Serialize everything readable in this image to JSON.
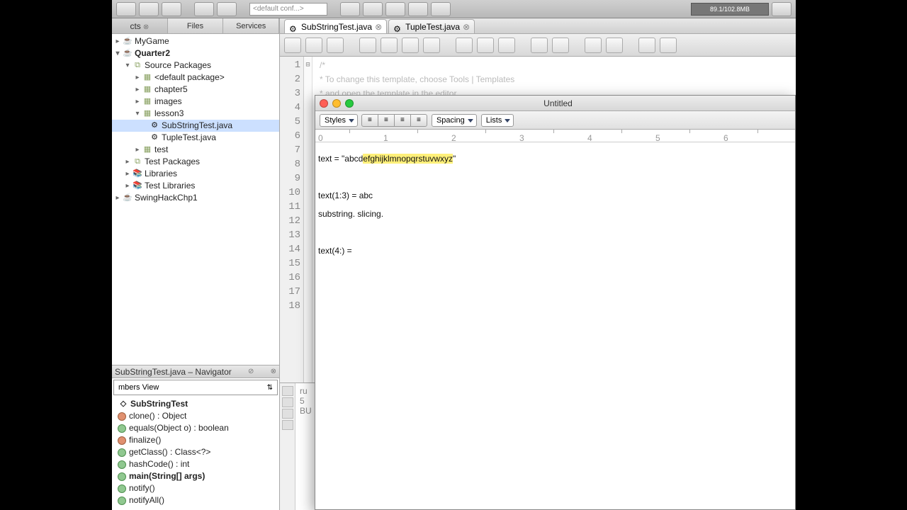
{
  "top_toolbar": {
    "config_dd": "<default conf...>",
    "memory": "89.1/102.8MB"
  },
  "project_tabs": {
    "tab1": "cts",
    "tab2": "Files",
    "tab3": "Services"
  },
  "tree": {
    "mygame": "MyGame",
    "quarter2": "Quarter2",
    "src_pkg": "Source Packages",
    "default_pkg": "<default package>",
    "chapter5": "chapter5",
    "images": "images",
    "lesson3": "lesson3",
    "substring": "SubStringTest.java",
    "tupletest": "TupleTest.java",
    "test": "test",
    "test_pkg": "Test Packages",
    "libraries": "Libraries",
    "test_libraries": "Test Libraries",
    "swinghack": "SwingHackChp1"
  },
  "navigator": {
    "title": "SubStringTest.java – Navigator",
    "view": "mbers View",
    "class": "SubStringTest",
    "m_clone": "clone() : Object",
    "m_equals": "equals(Object o) : boolean",
    "m_finalize": "finalize()",
    "m_getclass": "getClass() : Class<?>",
    "m_hashcode": "hashCode() : int",
    "m_main": "main(String[] args)",
    "m_notify": "notify()",
    "m_notifyall": "notifyAll()"
  },
  "editor_tabs": {
    "tab1": "SubStringTest.java",
    "tab2": "TupleTest.java"
  },
  "code": {
    "l1": "/*",
    "l2": " * To change this template, choose Tools | Templates",
    "l3": " * and open the template in the editor"
  },
  "output": {
    "l1": "ru",
    "l2": "5",
    "l3": "BU"
  },
  "textedit": {
    "title": "Untitled",
    "dd_styles": "Styles",
    "dd_spacing": "Spacing",
    "dd_lists": "Lists",
    "line1_a": "text = \"abcd",
    "line1_b": "efghijklmnopqrstuvwxyz",
    "line1_c": "\"",
    "line2": "text(1:3) = abc",
    "line3": "substring.  slicing.",
    "line4": "text(4:) ="
  }
}
